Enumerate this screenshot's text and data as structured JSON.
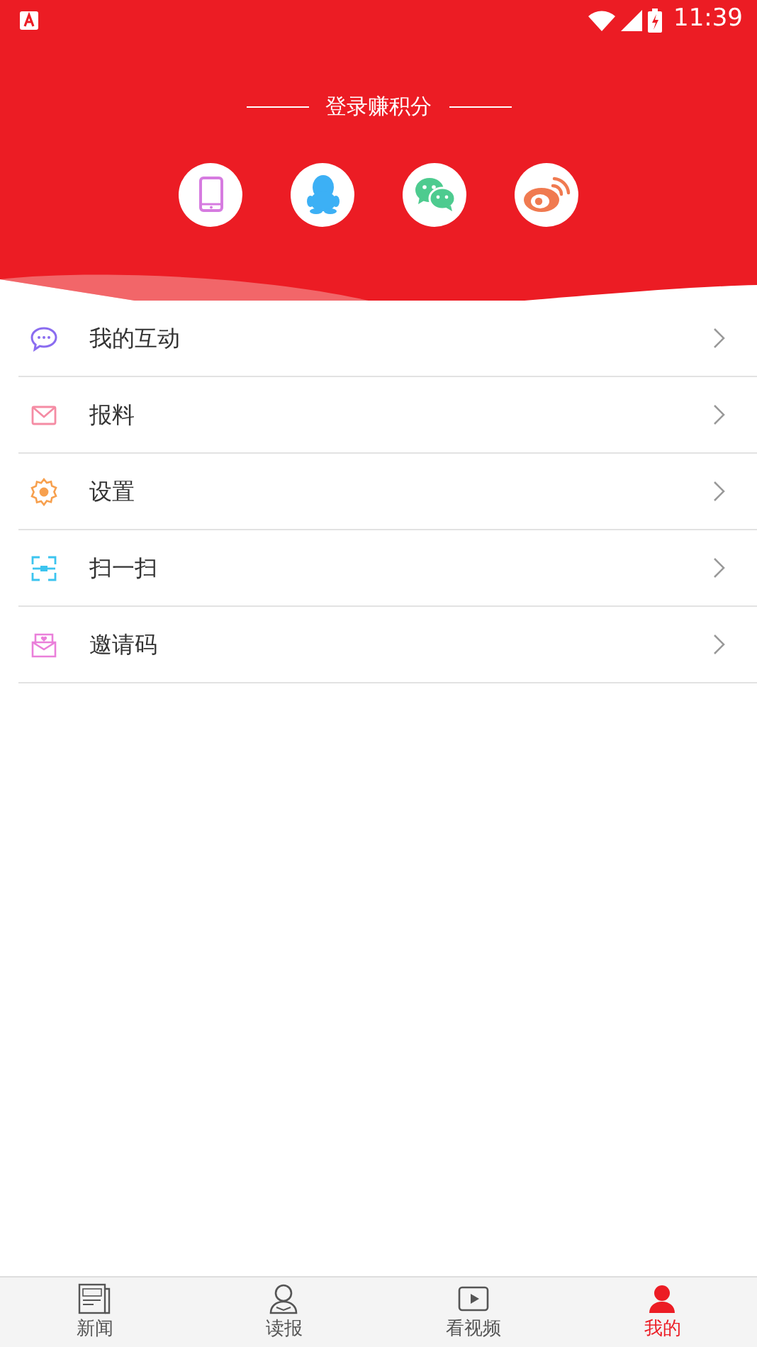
{
  "status_bar": {
    "time": "11:39"
  },
  "header": {
    "title": "登录赚积分",
    "login_options": [
      {
        "kind": "phone"
      },
      {
        "kind": "penguin"
      },
      {
        "kind": "chat"
      },
      {
        "kind": "eye"
      }
    ]
  },
  "menu": [
    {
      "label": "我的互动",
      "kind": "comment"
    },
    {
      "label": "报料",
      "kind": "mail"
    },
    {
      "label": "设置",
      "kind": "gear"
    },
    {
      "label": "扫一扫",
      "kind": "scan"
    },
    {
      "label": "邀请码",
      "kind": "invite"
    }
  ],
  "tabs": [
    {
      "label": "新闻",
      "kind": "news",
      "selected": false
    },
    {
      "label": "读报",
      "kind": "reader",
      "selected": false
    },
    {
      "label": "看视频",
      "kind": "video",
      "selected": false
    },
    {
      "label": "我的",
      "kind": "me",
      "selected": true
    }
  ]
}
